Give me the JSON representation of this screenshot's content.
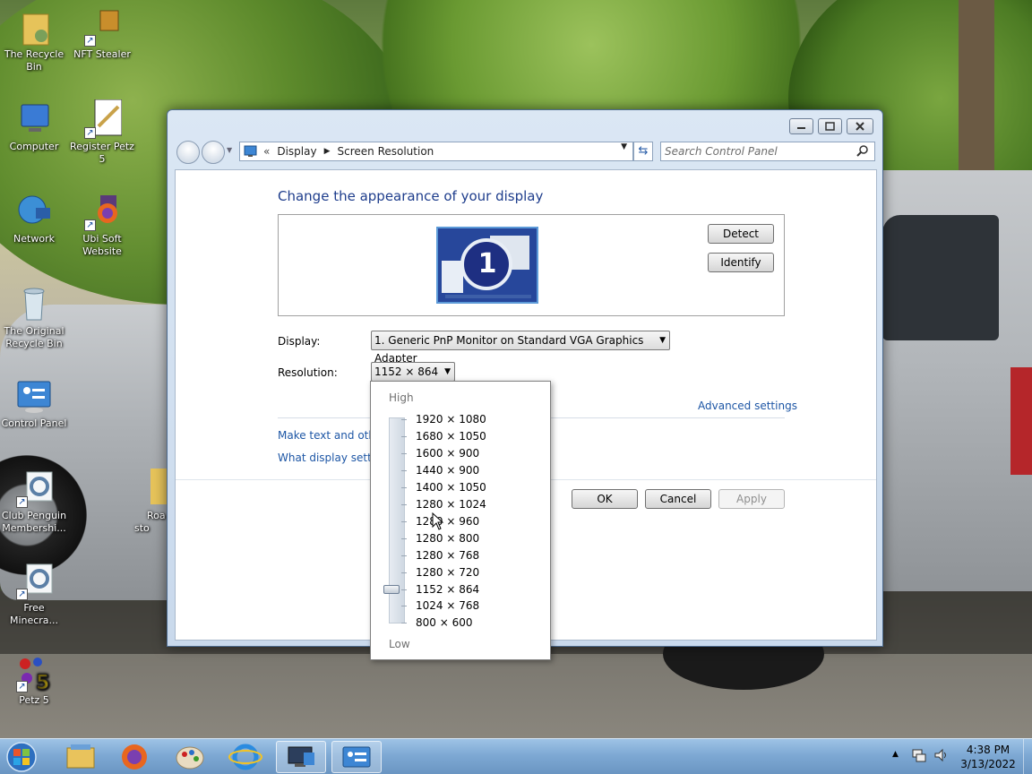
{
  "desktop": {
    "icons": [
      {
        "label": "The Recycle Bin",
        "icon": "folder-user-icon"
      },
      {
        "label": "NFT Stealer",
        "icon": "shortcut-app-icon"
      },
      {
        "label": "Computer",
        "icon": "computer-icon"
      },
      {
        "label": "Register Petz 5",
        "icon": "pen-paper-icon"
      },
      {
        "label": "Network",
        "icon": "network-globe-icon"
      },
      {
        "label": "Ubi Soft Website",
        "icon": "firefox-icon"
      },
      {
        "label": "The Original Recycle Bin",
        "icon": "recycle-bin-icon"
      },
      {
        "label": "Control Panel",
        "icon": "control-panel-icon"
      },
      {
        "label": "Club Penguin Membershi...",
        "icon": "gear-icon"
      },
      {
        "label": "Free Minecra...",
        "icon": "gear-icon"
      },
      {
        "label": "Petz 5",
        "icon": "petz-icon"
      },
      {
        "label": "Roa sto",
        "icon": "folder-icon"
      }
    ]
  },
  "window": {
    "breadcrumb": {
      "root": "Display",
      "current": "Screen Resolution",
      "overflow": "«"
    },
    "search": {
      "placeholder": "Search Control Panel"
    },
    "page_title": "Change the appearance of your display",
    "monitor_number": "1",
    "buttons": {
      "detect": "Detect",
      "identify": "Identify",
      "ok": "OK",
      "cancel": "Cancel",
      "apply": "Apply"
    },
    "display_label": "Display:",
    "display_value": "1. Generic PnP Monitor on Standard VGA Graphics Adapter",
    "resolution_label": "Resolution:",
    "resolution_value": "1152 × 864",
    "advanced_settings": "Advanced settings",
    "link_text_size": "Make text and other",
    "link_display_settings": "What display setting"
  },
  "resolution_dropdown": {
    "high_label": "High",
    "low_label": "Low",
    "options": [
      "1920 × 1080",
      "1680 × 1050",
      "1600 × 900",
      "1440 × 900",
      "1400 × 1050",
      "1280 × 1024",
      "1280 × 960",
      "1280 × 800",
      "1280 × 768",
      "1280 × 720",
      "1152 × 864",
      "1024 × 768",
      "800 × 600"
    ],
    "selected": "1152 × 864"
  },
  "taskbar": {
    "apps": [
      "start-orb-icon",
      "file-explorer-icon",
      "firefox-icon",
      "paint-icon",
      "internet-explorer-icon",
      "remote-desktop-icon",
      "control-panel-icon"
    ],
    "time": "4:38 PM",
    "date": "3/13/2022"
  },
  "colors": {
    "title_blue": "#1e3d8c",
    "link_blue": "#1d56a5",
    "taskbar": "#7ea9d4"
  }
}
